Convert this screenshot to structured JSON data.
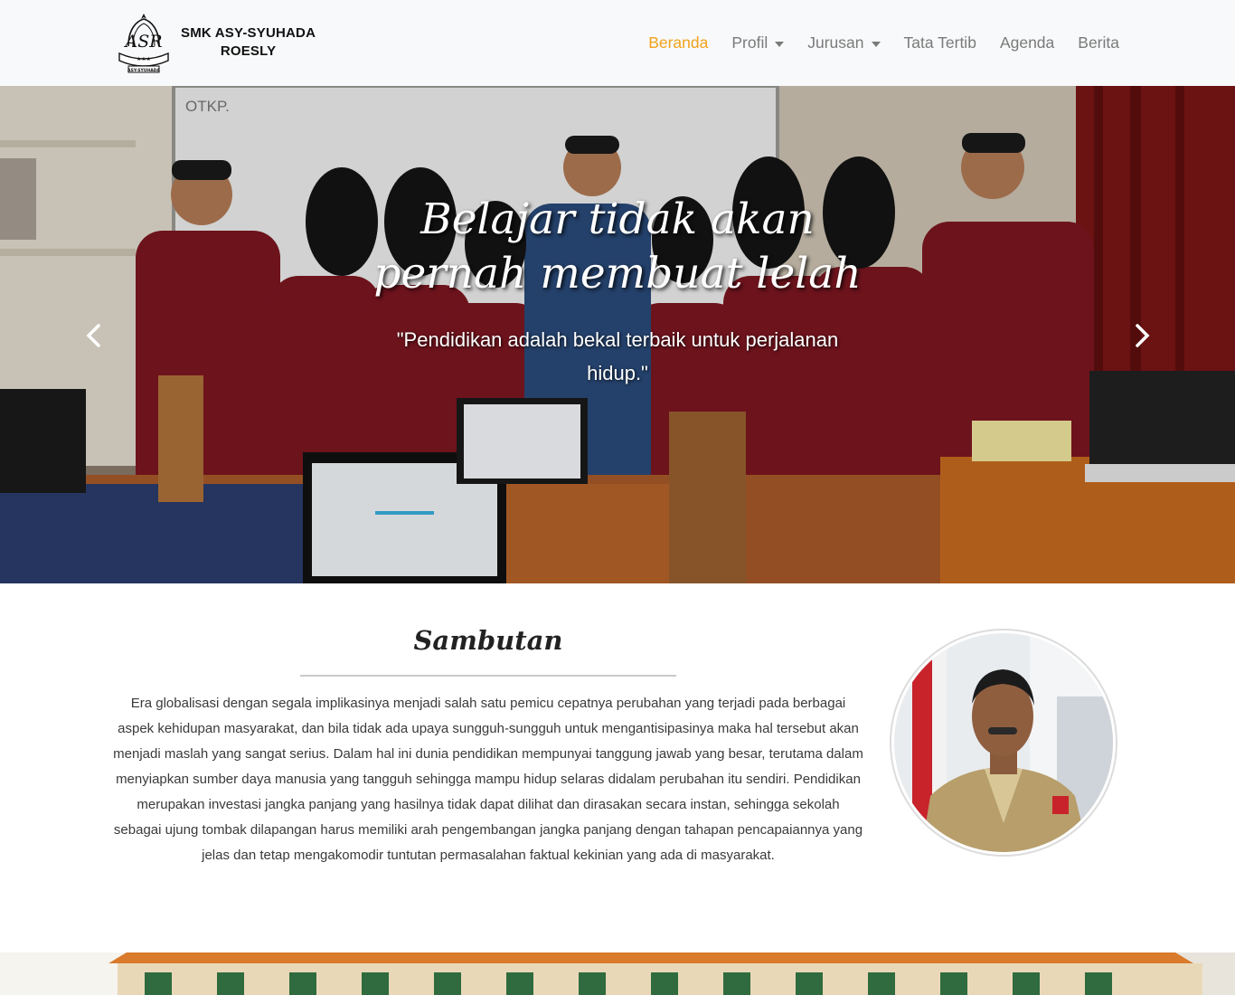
{
  "navbar": {
    "brand_line1": "SMK ASY-SYUHADA",
    "brand_line2": "ROESLY",
    "logo_icon": "school-emblem-icon",
    "items": [
      {
        "label": "Beranda",
        "active": true,
        "dropdown": false
      },
      {
        "label": "Profil",
        "active": false,
        "dropdown": true
      },
      {
        "label": "Jurusan",
        "active": false,
        "dropdown": true
      },
      {
        "label": "Tata Tertib",
        "active": false,
        "dropdown": false
      },
      {
        "label": "Agenda",
        "active": false,
        "dropdown": false
      },
      {
        "label": "Berita",
        "active": false,
        "dropdown": false
      }
    ],
    "active_color": "#f0a21b",
    "text_color": "#7a7a7a"
  },
  "hero": {
    "heading": "Belajar tidak akan pernah membuat lelah",
    "quote": "\"Pendidikan adalah bekal terbaik untuk perjalanan hidup.\"",
    "board_label": "OTKP.",
    "prev_icon": "chevron-left-icon",
    "next_icon": "chevron-right-icon"
  },
  "sambutan": {
    "title": "Sambutan",
    "body": "Era globalisasi dengan segala implikasinya menjadi salah satu pemicu cepatnya perubahan yang terjadi pada berbagai aspek kehidupan masyarakat, dan bila tidak ada upaya sungguh-sungguh untuk mengantisipasinya maka hal tersebut akan menjadi maslah yang sangat serius. Dalam hal ini dunia pendidikan mempunyai tanggung jawab yang besar, terutama dalam menyiapkan sumber daya manusia yang tangguh sehingga mampu hidup selaras didalam perubahan itu sendiri. Pendidikan merupakan investasi jangka panjang yang hasilnya tidak dapat dilihat dan dirasakan secara instan, sehingga sekolah sebagai ujung tombak dilapangan harus memiliki arah pengembangan jangka panjang dengan tahapan pencapaiannya yang jelas dan tetap mengakomodir tuntutan permasalahan faktual kekinian yang ada di masyarakat."
  }
}
